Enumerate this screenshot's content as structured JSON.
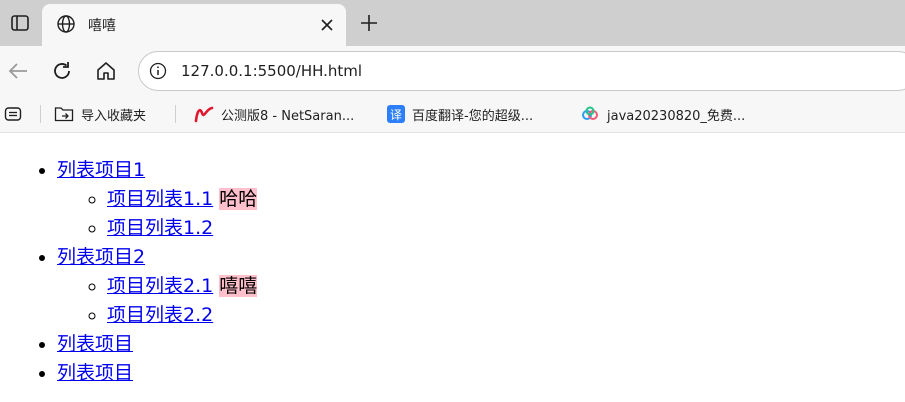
{
  "browser": {
    "tab": {
      "title": "嘻嘻"
    },
    "url": "127.0.0.1:5500/HH.html",
    "bookmarks": [
      {
        "label": "导入收藏夹"
      },
      {
        "label": "公测版8 - NetSaran..."
      },
      {
        "label": "百度翻译-您的超级..."
      },
      {
        "label": "java20230820_免费..."
      }
    ],
    "fanyi_glyph": "译"
  },
  "page": {
    "list": [
      {
        "label": "列表项目1",
        "children": [
          {
            "label": "项目列表1.1",
            "note": "哈哈"
          },
          {
            "label": "项目列表1.2"
          }
        ]
      },
      {
        "label": "列表项目2",
        "children": [
          {
            "label": "项目列表2.1",
            "note": "嘻嘻"
          },
          {
            "label": "项目列表2.2"
          }
        ]
      },
      {
        "label": "列表项目"
      },
      {
        "label": "列表项目"
      }
    ],
    "colors": {
      "link": "#0000ee",
      "highlight": "#ffc0cb"
    }
  }
}
